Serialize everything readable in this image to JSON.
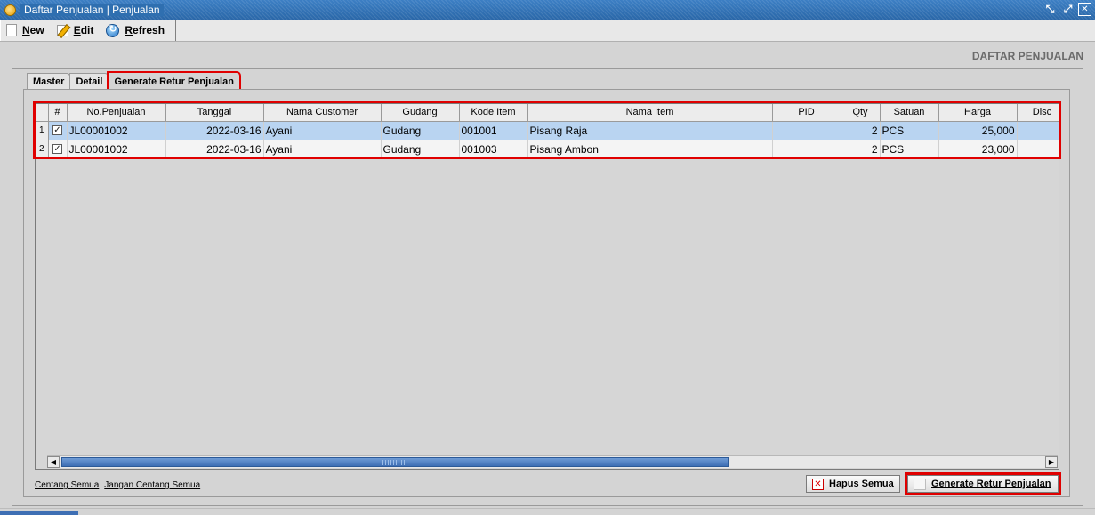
{
  "window": {
    "title": "Daftar Penjualan | Penjualan"
  },
  "toolbar": {
    "new_label": "New",
    "edit_label": "Edit",
    "refresh_label": "Refresh"
  },
  "page_heading": "DAFTAR PENJUALAN",
  "tabs": [
    {
      "label": "Master",
      "active": false
    },
    {
      "label": "Detail",
      "active": false
    },
    {
      "label": "Generate Retur Penjualan",
      "active": true
    }
  ],
  "grid": {
    "columns": [
      "#",
      "No.Penjualan",
      "Tanggal",
      "Nama Customer",
      "Gudang",
      "Kode Item",
      "Nama Item",
      "PID",
      "Qty",
      "Satuan",
      "Harga",
      "Disc"
    ],
    "rows": [
      {
        "row_no": "1",
        "checked": true,
        "no_penjualan": "JL00001002",
        "tanggal": "2022-03-16",
        "customer": "Ayani",
        "gudang": "Gudang",
        "kode_item": "001001",
        "nama_item": "Pisang Raja",
        "pid": "",
        "qty": "2",
        "satuan": "PCS",
        "harga": "25,000",
        "disc": ""
      },
      {
        "row_no": "2",
        "checked": true,
        "no_penjualan": "JL00001002",
        "tanggal": "2022-03-16",
        "customer": "Ayani",
        "gudang": "Gudang",
        "kode_item": "001003",
        "nama_item": "Pisang Ambon",
        "pid": "",
        "qty": "2",
        "satuan": "PCS",
        "harga": "23,000",
        "disc": ""
      }
    ]
  },
  "links": {
    "check_all": "Centang Semua",
    "uncheck_all": "Jangan Centang Semua"
  },
  "buttons": {
    "hapus_semua": "Hapus Semua",
    "generate_retur": "Generate Retur Penjualan"
  },
  "colors": {
    "title_bar": "#2d6fb3",
    "selection": "#b9d4f1",
    "highlight": "#e00000"
  }
}
